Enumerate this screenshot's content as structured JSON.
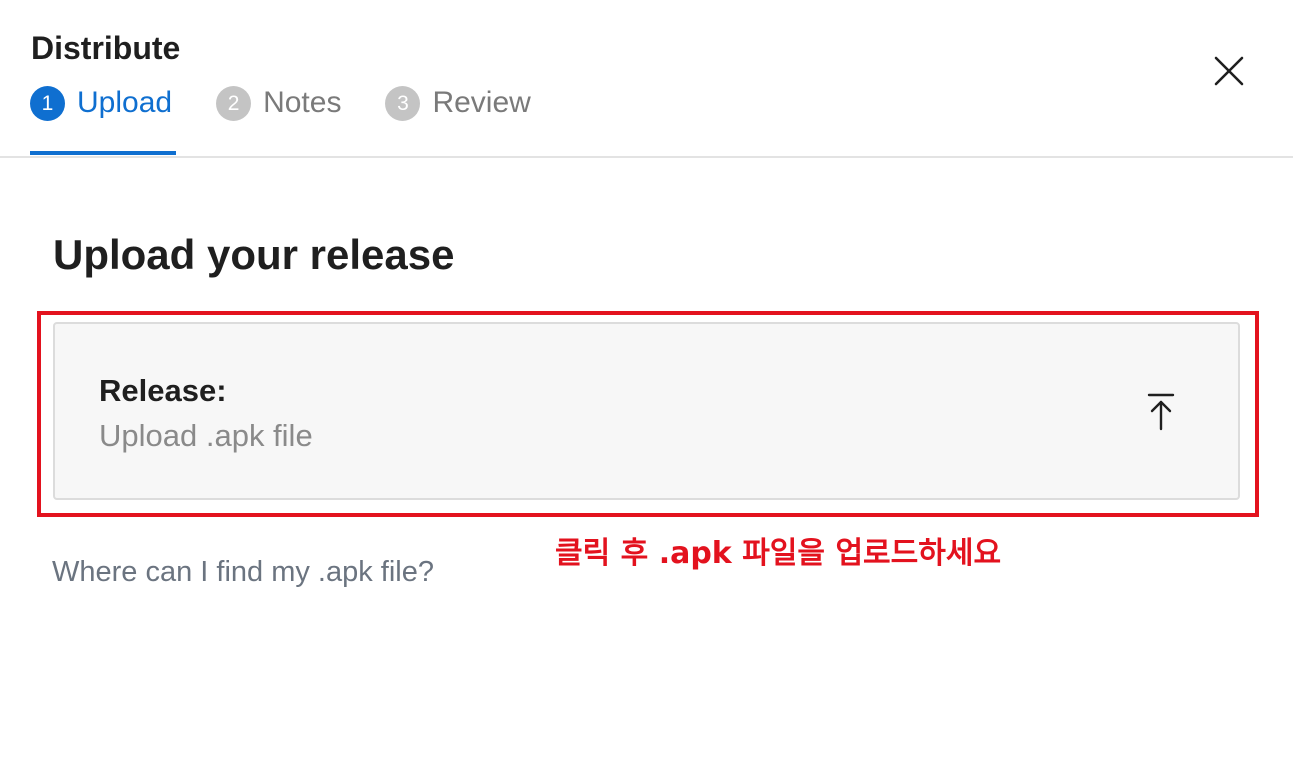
{
  "dialog": {
    "title": "Distribute",
    "close_icon": "close-icon"
  },
  "steps": [
    {
      "number": "1",
      "label": "Upload",
      "active": true
    },
    {
      "number": "2",
      "label": "Notes",
      "active": false
    },
    {
      "number": "3",
      "label": "Review",
      "active": false
    }
  ],
  "main": {
    "section_title": "Upload your release",
    "upload_card": {
      "label": "Release:",
      "sub_label": "Upload .apk file",
      "icon": "upload-icon"
    },
    "help_link": "Where can I find my .apk file?",
    "annotation": "클릭 후 .apk 파일을 업로드하세요"
  },
  "colors": {
    "accent": "#0f6fd0",
    "annotation_red": "#e3121e",
    "inactive_step": "#c4c4c4",
    "card_bg": "#f7f7f7"
  }
}
